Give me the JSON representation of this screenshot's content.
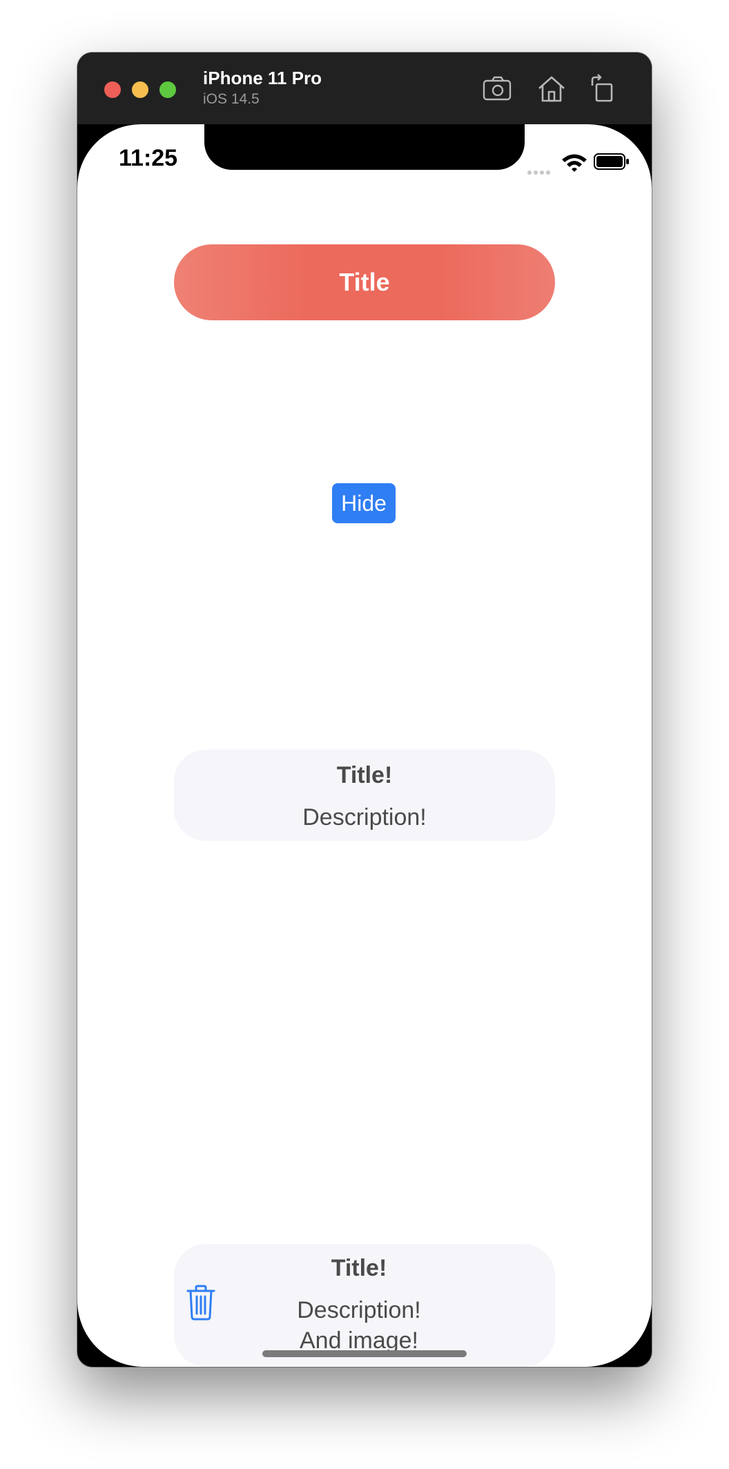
{
  "simulator": {
    "device_name": "iPhone 11 Pro",
    "os_version": "iOS 14.5",
    "toolbar_icons": [
      "screenshot-icon",
      "home-icon",
      "rotate-icon"
    ]
  },
  "status_bar": {
    "time": "11:25",
    "icons": [
      "cellular-signal-icon",
      "wifi-icon",
      "battery-icon"
    ]
  },
  "banner": {
    "title": "Title",
    "color": "#ec6a5c"
  },
  "hide_button": {
    "label": "Hide",
    "color": "#2f7ef3"
  },
  "cards": [
    {
      "title": "Title!",
      "description": "Description!"
    },
    {
      "title": "Title!",
      "description_line1": "Description!",
      "description_line2": "And image!",
      "icon": "trash-icon"
    }
  ]
}
